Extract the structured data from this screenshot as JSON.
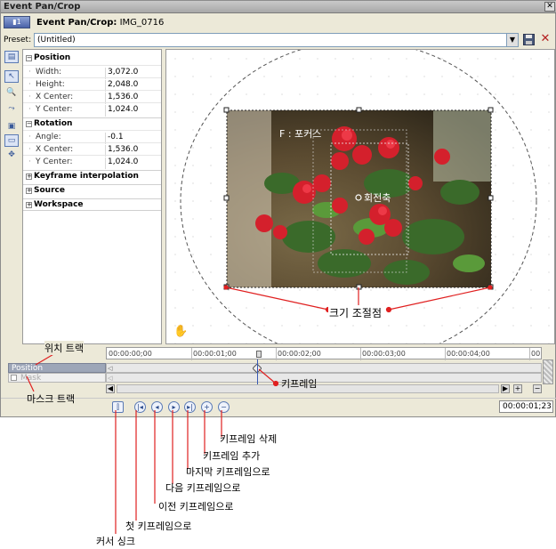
{
  "window": {
    "title": "Event Pan/Crop",
    "close_symbol": "✕"
  },
  "header": {
    "label": "Event Pan/Crop:",
    "clip": "IMG_0716"
  },
  "preset": {
    "label": "Preset:",
    "value": "(Untitled)"
  },
  "properties": {
    "position": {
      "label": "Position",
      "rows": [
        {
          "key": "Width:",
          "value": "3,072.0"
        },
        {
          "key": "Height:",
          "value": "2,048.0"
        },
        {
          "key": "X Center:",
          "value": "1,536.0"
        },
        {
          "key": "Y Center:",
          "value": "1,024.0"
        }
      ]
    },
    "rotation": {
      "label": "Rotation",
      "rows": [
        {
          "key": "Angle:",
          "value": "-0.1"
        },
        {
          "key": "X Center:",
          "value": "1,536.0"
        },
        {
          "key": "Y Center:",
          "value": "1,024.0"
        }
      ]
    },
    "collapsed": [
      {
        "label": "Keyframe interpolation"
      },
      {
        "label": "Source"
      },
      {
        "label": "Workspace"
      }
    ]
  },
  "canvas": {
    "focus_label": "F : 포커스",
    "rotation_label": "회전축",
    "resize_label": "크기 조절점"
  },
  "timeline": {
    "ruler": [
      "00:00:00;00",
      "00:00:01;00",
      "00:00:02;00",
      "00:00:03;00",
      "00:00:04;00",
      "00"
    ],
    "tracks": [
      {
        "label": "Position"
      },
      {
        "label": "Mask"
      }
    ],
    "timecode": "00:00:01;23"
  },
  "annotations": {
    "position_track": "위치 트랙",
    "mask_track": "마스크 트랙",
    "keyframe": "키프레임",
    "delete_keyframe": "키프레임 삭제",
    "add_keyframe": "키프레임 추가",
    "last_keyframe": "마지막 키프레임으로",
    "next_keyframe": "다음 키프레임으로",
    "prev_keyframe": "이전 키프레임으로",
    "first_keyframe": "첫 키프레임으로",
    "cursor_sync": "커서 싱크"
  }
}
